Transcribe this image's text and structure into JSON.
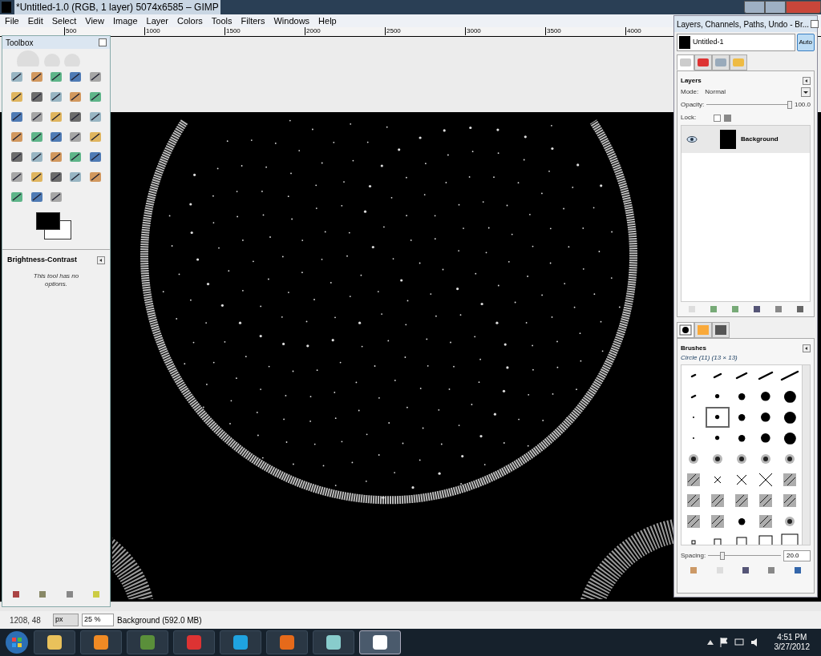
{
  "window": {
    "title": "*Untitled-1.0 (RGB, 1 layer) 5074x6585 – GIMP"
  },
  "menu": [
    "File",
    "Edit",
    "Select",
    "View",
    "Image",
    "Layer",
    "Colors",
    "Tools",
    "Filters",
    "Windows",
    "Help"
  ],
  "ruler": [
    "500",
    "1000",
    "1500",
    "2000",
    "2500",
    "3000",
    "3500",
    "4000"
  ],
  "toolbox": {
    "title": "Toolbox",
    "options_title": "Brightness-Contrast",
    "options_message": "This tool has no options."
  },
  "dock": {
    "title": "Layers, Channels, Paths, Undo - Br...",
    "image": "Untitled-1",
    "auto_button": "Auto",
    "tabs": [
      {
        "selected": true
      },
      {
        "selected": false
      },
      {
        "selected": false
      },
      {
        "selected": false
      }
    ],
    "layers": {
      "title": "Layers",
      "mode_label": "Mode:",
      "mode": "Normal",
      "opacity": {
        "label": "Opacity:",
        "level": 1,
        "value": "100.0"
      },
      "lock_label": "Lock:",
      "lock_pixels_checked": false,
      "items": [
        {
          "name": "Background",
          "visible": true,
          "selected": true
        }
      ]
    },
    "brush_tabs": [
      {
        "selected": true
      },
      {
        "selected": false
      },
      {
        "selected": false
      }
    ],
    "brushes": {
      "title": "Brushes",
      "current": "Circle (11) (13 × 13)",
      "spacing": {
        "label": "Spacing:",
        "level": 0.2,
        "value": "20.0"
      },
      "items": [
        {
          "kind": "stroke",
          "selected": false
        },
        {
          "kind": "stroke",
          "selected": false
        },
        {
          "kind": "stroke",
          "selected": false
        },
        {
          "kind": "stroke",
          "selected": false
        },
        {
          "kind": "stroke",
          "selected": false
        },
        {
          "kind": "stroke",
          "selected": false
        },
        {
          "kind": "dot",
          "selected": false
        },
        {
          "kind": "dot",
          "selected": false
        },
        {
          "kind": "dot",
          "selected": false
        },
        {
          "kind": "dot",
          "selected": false
        },
        {
          "kind": "dot",
          "selected": false
        },
        {
          "kind": "dot",
          "selected": true
        },
        {
          "kind": "dot",
          "selected": false
        },
        {
          "kind": "dot",
          "selected": false
        },
        {
          "kind": "dot",
          "selected": false
        },
        {
          "kind": "dot",
          "selected": false
        },
        {
          "kind": "dot",
          "selected": false
        },
        {
          "kind": "dot",
          "selected": false
        },
        {
          "kind": "dot",
          "selected": false
        },
        {
          "kind": "dot",
          "selected": false
        },
        {
          "kind": "fuzzy",
          "selected": false
        },
        {
          "kind": "fuzzy",
          "selected": false
        },
        {
          "kind": "fuzzy",
          "selected": false
        },
        {
          "kind": "fuzzy",
          "selected": false
        },
        {
          "kind": "fuzzy",
          "selected": false
        },
        {
          "kind": "texture",
          "selected": false
        },
        {
          "kind": "cross",
          "selected": false
        },
        {
          "kind": "cross",
          "selected": false
        },
        {
          "kind": "cross",
          "selected": false
        },
        {
          "kind": "texture",
          "selected": false
        },
        {
          "kind": "texture",
          "selected": false
        },
        {
          "kind": "texture",
          "selected": false
        },
        {
          "kind": "texture",
          "selected": false
        },
        {
          "kind": "texture",
          "selected": false
        },
        {
          "kind": "texture",
          "selected": false
        },
        {
          "kind": "texture",
          "selected": false
        },
        {
          "kind": "texture",
          "selected": false
        },
        {
          "kind": "dot",
          "selected": false
        },
        {
          "kind": "texture",
          "selected": false
        },
        {
          "kind": "fuzzy",
          "selected": false
        },
        {
          "kind": "square",
          "selected": false
        },
        {
          "kind": "square",
          "selected": false
        },
        {
          "kind": "square",
          "selected": false
        },
        {
          "kind": "square",
          "selected": false
        },
        {
          "kind": "square",
          "selected": false
        }
      ]
    }
  },
  "status": {
    "coords": "1208, 48",
    "unit": "px",
    "zoom": "25 %",
    "message": "Background (592.0 MB)"
  },
  "taskbar": {
    "apps": [
      {
        "selected": false
      },
      {
        "selected": false
      },
      {
        "selected": false
      },
      {
        "selected": false
      },
      {
        "selected": false
      },
      {
        "selected": false
      },
      {
        "selected": false
      },
      {
        "selected": true
      }
    ],
    "time": "4:51 PM",
    "date": "3/27/2012"
  }
}
